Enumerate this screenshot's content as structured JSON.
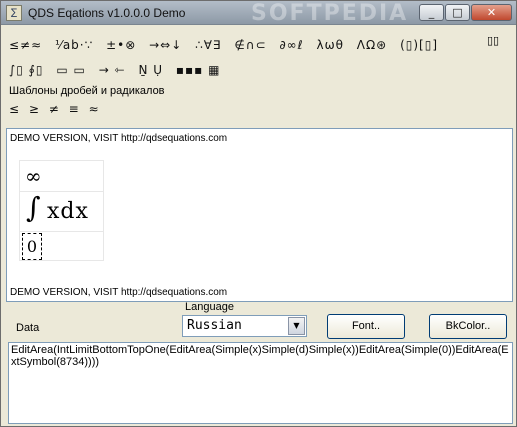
{
  "window": {
    "title": "QDS Eqations v1.0.0.0 Demo",
    "watermark": "SOFTPEDIA",
    "buttons": {
      "minimize": "_",
      "maximize": "□",
      "close": "✕"
    }
  },
  "toolbar": {
    "row1": [
      "≤≠≈",
      "⅟ab·∵",
      "±•⊗",
      "→⇔↓",
      "∴∀∃",
      "∉∩⊂",
      "∂∞ℓ",
      "λωθ",
      "ΛΩ⊛",
      "(▯)[▯]"
    ],
    "row1_end": "▯▯",
    "row2": [
      "∫▯ ∮▯",
      "▭ ▭",
      "→ ⇽",
      "Ṉ Ụ",
      "▪▪▪ ▦"
    ],
    "templates_label": "Шаблоны дробей и радикалов",
    "row3": [
      "≤",
      "≥",
      "≠",
      "≡",
      "≈"
    ]
  },
  "editor": {
    "demo_notice_top": "DEMO VERSION, VISIT http://qdsequations.com",
    "formula": {
      "upper_limit": "∞",
      "integral_sign": "∫",
      "integrand": "xdx",
      "lower_limit": "0"
    },
    "demo_notice_bottom": "DEMO VERSION, VISIT http://qdsequations.com"
  },
  "controls": {
    "language_label": "Language",
    "language_value": "Russian",
    "data_label": "Data",
    "font_button": "Font..",
    "bkcolor_button": "BkColor.."
  },
  "code": {
    "text": "EditArea(IntLimitBottomTopOne(EditArea(Simple(x)Simple(d)Simple(x))EditArea(Simple(0))EditArea(ExtSymbol(8734))))"
  },
  "colors": {
    "window_bg": "#ece9d8",
    "titlebar": "#9aa5b1",
    "field_border": "#7f9db9"
  }
}
